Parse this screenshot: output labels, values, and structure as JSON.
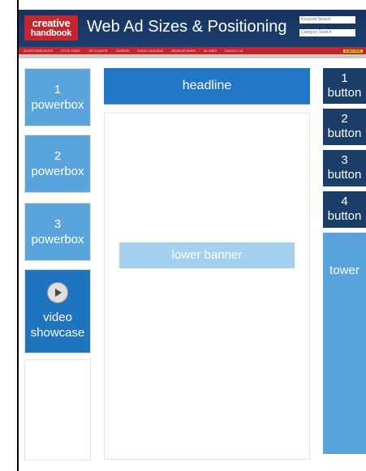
{
  "header": {
    "logo_line1": "creative",
    "logo_line2": "handbook",
    "title": "Web Ad Sizes & Positioning",
    "search1_placeholder": "Keyword Search",
    "search2_placeholder": "Category Search",
    "nav_items": [
      "ADVERTISING RATES",
      "STYLE CHART",
      "GET A QUOTE",
      "CAREERS",
      "EVENT CALENDAR",
      "MEDIA NETWORK",
      "AD SIZES",
      "CONTACT US"
    ],
    "nav_highlight": "SUBSCRIBE"
  },
  "left": {
    "powerbox1": {
      "number": "1",
      "label": "powerbox"
    },
    "powerbox2": {
      "number": "2",
      "label": "powerbox"
    },
    "powerbox3": {
      "number": "3",
      "label": "powerbox"
    },
    "video": {
      "line1": "video",
      "line2": "showcase"
    }
  },
  "center": {
    "headline": "headline",
    "lower_banner": "lower banner"
  },
  "right": {
    "button1": {
      "number": "1",
      "label": "button"
    },
    "button2": {
      "number": "2",
      "label": "button"
    },
    "button3": {
      "number": "3",
      "label": "button"
    },
    "button4": {
      "number": "4",
      "label": "button"
    },
    "tower": "tower"
  },
  "colors": {
    "header_bg": "#16335e",
    "nav_red": "#c4262e",
    "powerbox_blue": "#5aa4de",
    "headline_blue": "#2077c5",
    "button_navy": "#1b3e69",
    "lower_banner_blue": "#a6d0ef"
  },
  "icons": {
    "video_play": "play-circle-icon"
  }
}
